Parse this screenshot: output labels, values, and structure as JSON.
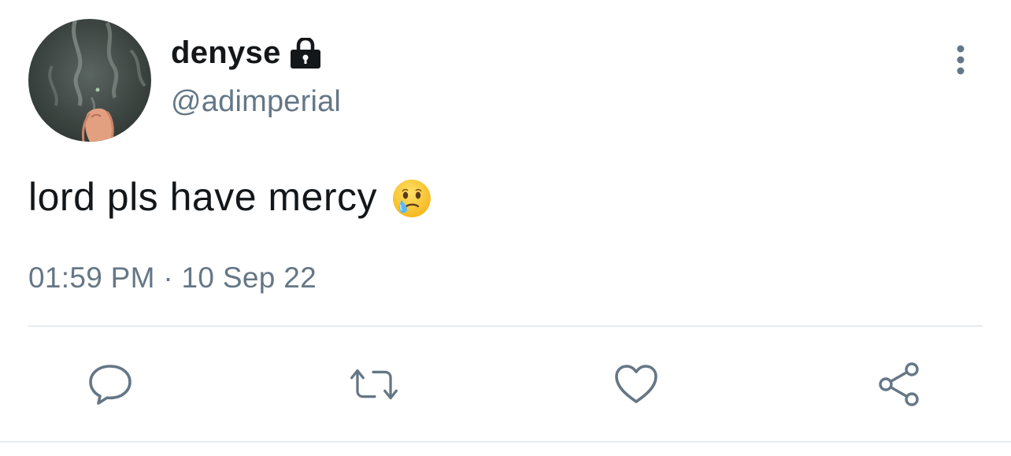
{
  "tweet": {
    "display_name": "denyse",
    "handle": "@adimperial",
    "text": "lord pls have mercy",
    "emoji": "face-holding-back-tears",
    "timestamp": "01:59 PM · 10 Sep 22",
    "protected": true
  },
  "icons": {
    "lock": "lock-icon",
    "more": "more-vertical-icon",
    "reply": "reply-icon",
    "retweet": "retweet-icon",
    "like": "heart-icon",
    "share": "share-icon"
  },
  "colors": {
    "text_primary": "#14171a",
    "text_secondary": "#657786",
    "divider": "#e6ecf0"
  }
}
